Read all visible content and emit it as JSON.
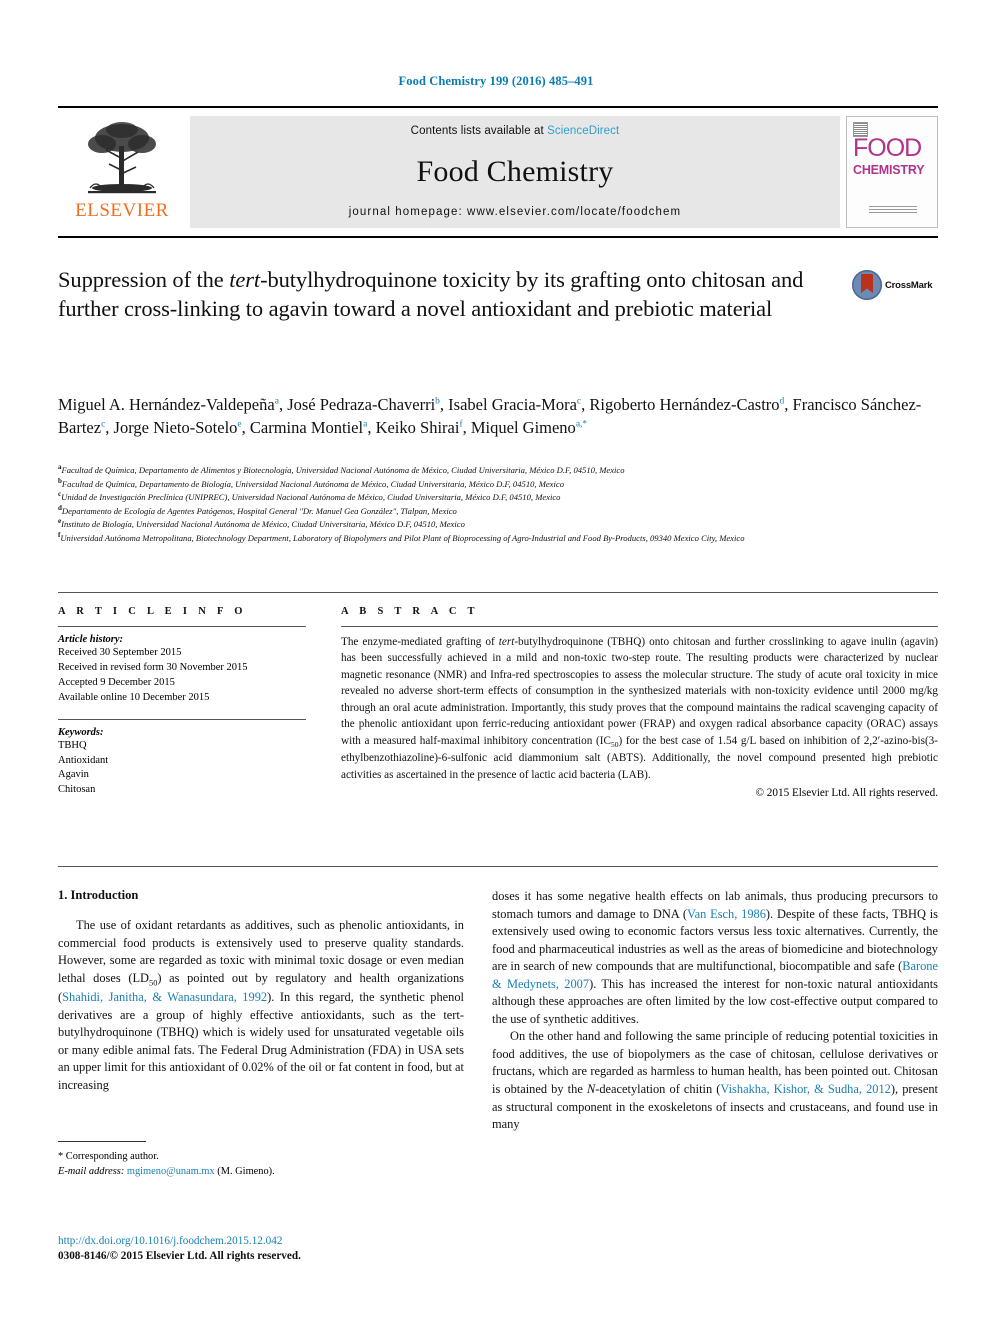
{
  "running_head": "Food Chemistry 199 (2016) 485–491",
  "masthead": {
    "publisher": "ELSEVIER",
    "contents_prefix": "Contents lists available at ",
    "contents_link": "ScienceDirect",
    "journal_name": "Food Chemistry",
    "homepage": "journal homepage: www.elsevier.com/locate/foodchem",
    "cover_title_line1": "FOOD",
    "cover_title_line2": "CHEMISTRY"
  },
  "title": {
    "part1": "Suppression of the ",
    "italic1": "tert",
    "part2": "-butylhydroquinone toxicity by its grafting onto chitosan and further cross-linking to agavin toward a novel antioxidant and prebiotic material",
    "crossmark_label": "CrossMark"
  },
  "authors": [
    {
      "name": "Miguel A. Hernández-Valdepeña",
      "sup": "a",
      "sep": ", "
    },
    {
      "name": "José Pedraza-Chaverri",
      "sup": "b",
      "sep": ", "
    },
    {
      "name": "Isabel Gracia-Mora",
      "sup": "c",
      "sep": ", "
    },
    {
      "name": "Rigoberto Hernández-Castro",
      "sup": "d",
      "sep": ", "
    },
    {
      "name": "Francisco Sánchez-Bartez",
      "sup": "c",
      "sep": ", "
    },
    {
      "name": "Jorge Nieto-Sotelo",
      "sup": "e",
      "sep": ", "
    },
    {
      "name": "Carmina Montiel",
      "sup": "a",
      "sep": ", "
    },
    {
      "name": "Keiko Shirai",
      "sup": "f",
      "sep": ", "
    },
    {
      "name": "Miquel Gimeno",
      "sup": "a,*",
      "sep": ""
    }
  ],
  "affiliations": [
    {
      "mark": "a",
      "text": "Facultad de Química, Departamento de Alimentos y Biotecnología, Universidad Nacional Autónoma de México, Ciudad Universitaria, México D.F, 04510, Mexico"
    },
    {
      "mark": "b",
      "text": "Facultad de Química, Departamento de Biología, Universidad Nacional Autónoma de México, Ciudad Universitaria, México D.F, 04510, Mexico"
    },
    {
      "mark": "c",
      "text": "Unidad de Investigación Preclínica (UNIPREC), Universidad Nacional Autónoma de México, Ciudad Universitaria, México D.F, 04510, Mexico"
    },
    {
      "mark": "d",
      "text": "Departamento de Ecología de Agentes Patógenos, Hospital General \"Dr. Manuel Gea González\", Tlalpan, Mexico"
    },
    {
      "mark": "e",
      "text": "Instituto de Biología, Universidad Nacional Autónoma de México, Ciudad Universitaria, México D.F, 04510, Mexico"
    },
    {
      "mark": "f",
      "text": "Universidad Autónoma Metropolitana, Biotechnology Department, Laboratory of Biopolymers and Pilot Plant of Bioprocessing of Agro-Industrial and Food By-Products, 09340 Mexico City, Mexico"
    }
  ],
  "article_info": {
    "heading": "A R T I C L E  I N F O",
    "history_label": "Article history:",
    "history": [
      "Received 30 September 2015",
      "Received in revised form 30 November 2015",
      "Accepted 9 December 2015",
      "Available online 10 December 2015"
    ],
    "keywords_label": "Keywords:",
    "keywords": [
      "TBHQ",
      "Antioxidant",
      "Agavin",
      "Chitosan"
    ]
  },
  "abstract": {
    "heading": "A B S T R A C T",
    "text_1": "The enzyme-mediated grafting of ",
    "italic_1": "tert",
    "text_2": "-butylhydroquinone (TBHQ) onto chitosan and further crosslinking to agave inulin (agavin) has been successfully achieved in a mild and non-toxic two-step route. The resulting products were characterized by nuclear magnetic resonance (NMR) and Infra-red spectroscopies to assess the molecular structure. The study of acute oral toxicity in mice revealed no adverse short-term effects of consumption in the synthesized materials with non-toxicity evidence until 2000 mg/kg through an oral acute administration. Importantly, this study proves that the compound maintains the radical scavenging capacity of the phenolic antioxidant upon ferric-reducing antioxidant power (FRAP) and oxygen radical absorbance capacity (ORAC) assays with a measured half-maximal inhibitory concentration (IC",
    "sub_1": "50",
    "text_3": ") for the best case of 1.54 g/L based on inhibition of 2,2′-azino-bis(3-ethylbenzothiazoline)-6-sulfonic acid diammonium salt (ABTS). Additionally, the novel compound presented high prebiotic activities as ascertained in the presence of lactic acid bacteria (LAB).",
    "copyright": "© 2015 Elsevier Ltd. All rights reserved."
  },
  "introduction": {
    "heading": "1. Introduction",
    "left_p1_a": "The use of oxidant retardants as additives, such as phenolic antioxidants, in commercial food products is extensively used to preserve quality standards. However, some are regarded as toxic with minimal toxic dosage or even median lethal doses (LD",
    "left_p1_sub": "50",
    "left_p1_b": ") as pointed out by regulatory and health organizations (",
    "left_p1_ref": "Shahidi, Janitha, & Wanasundara, 1992",
    "left_p1_c": "). In this regard, the synthetic phenol derivatives are a group of highly effective antioxidants, such as the tert-butylhydroquinone (TBHQ) which is widely used for unsaturated vegetable oils or many edible animal fats. The Federal Drug Administration (FDA) in USA sets an upper limit for this antioxidant of 0.02% of the oil or fat content in food, but at increasing",
    "right_p1_a": "doses it has some negative health effects on lab animals, thus producing precursors to stomach tumors and damage to DNA (",
    "right_p1_ref1": "Van Esch, 1986",
    "right_p1_b": "). Despite of these facts, TBHQ is extensively used owing to economic factors versus less toxic alternatives. Currently, the food and pharmaceutical industries as well as the areas of biomedicine and biotechnology are in search of new compounds that are multifunctional, biocompatible and safe (",
    "right_p1_ref2": "Barone & Medynets, 2007",
    "right_p1_c": "). This has increased the interest for non-toxic natural antioxidants although these approaches are often limited by the low cost-effective output compared to the use of synthetic additives.",
    "right_p2_a": "On the other hand and following the same principle of reducing potential toxicities in food additives, the use of biopolymers as the case of chitosan, cellulose derivatives or fructans, which are regarded as harmless to human health, has been pointed out. Chitosan is obtained by the ",
    "right_p2_italic": "N",
    "right_p2_b": "-deacetylation of chitin (",
    "right_p2_ref": "Vishakha, Kishor, & Sudha, 2012",
    "right_p2_c": "), present as structural component in the exoskeletons of insects and crustaceans, and found use in many"
  },
  "footnote": {
    "corresponding": "* Corresponding author.",
    "email_label": "E-mail address:",
    "email": "mgimeno@unam.mx",
    "email_owner": "(M. Gimeno)."
  },
  "footer": {
    "doi": "http://dx.doi.org/10.1016/j.foodchem.2015.12.042",
    "issn": "0308-8146/© 2015 Elsevier Ltd. All rights reserved."
  },
  "colors": {
    "link": "#1a7fb3",
    "running_head": "#0b7cb0",
    "elsevier_orange": "#f06f1e",
    "cover_magenta": "#b0338c",
    "band_gray": "#e7e7e7"
  }
}
